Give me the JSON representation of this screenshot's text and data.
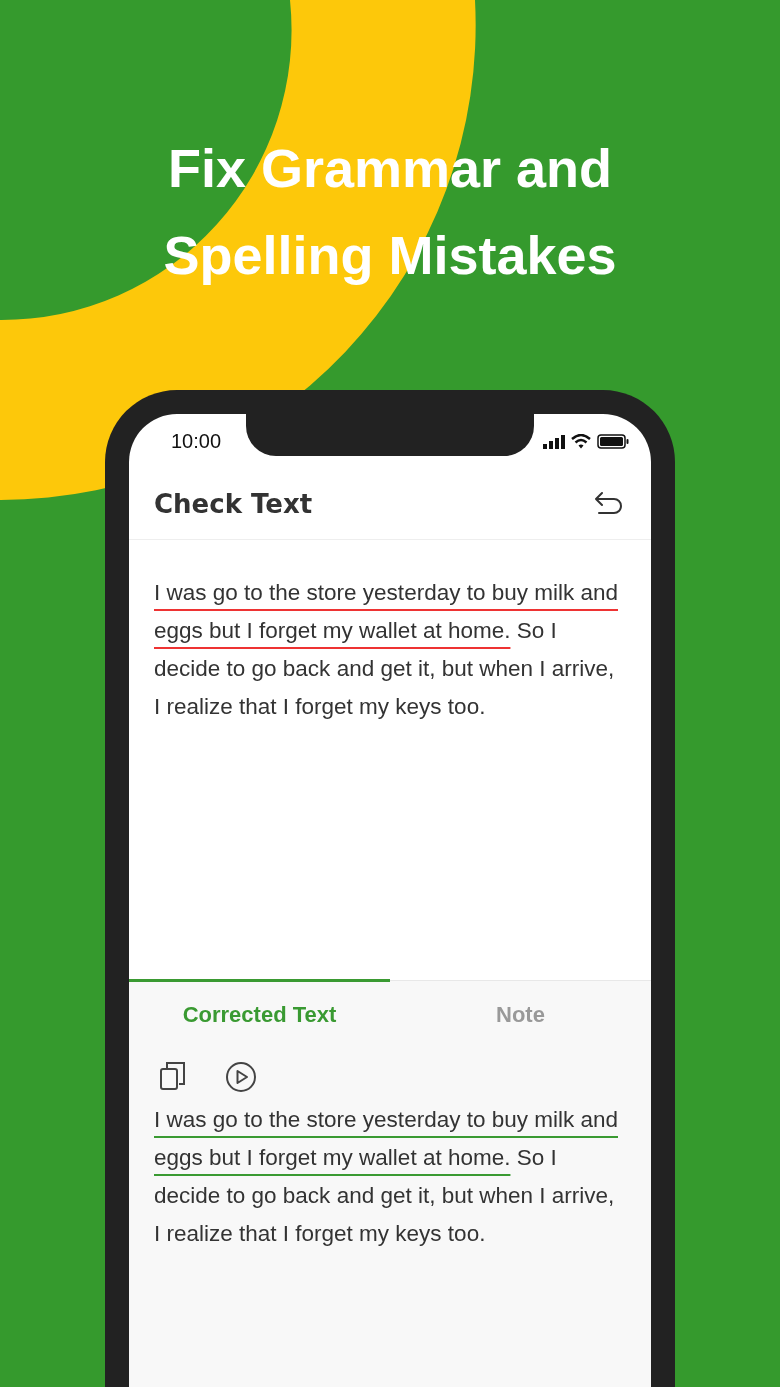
{
  "headline": [
    "Fix Grammar and",
    "Spelling Mistakes"
  ],
  "status_bar": {
    "time": "10:00"
  },
  "header": {
    "title": "Check Text"
  },
  "input_text": [
    {
      "text": "I was go to the store yesterday to buy milk and eggs but I forget my wallet at home.",
      "flagged": true
    },
    {
      "text": " So I decide to go back and get it, but when I arrive, I realize that I forget my keys too.",
      "flagged": false
    }
  ],
  "tabs": [
    {
      "label": "Corrected Text",
      "selected": true
    },
    {
      "label": "Note",
      "selected": false
    }
  ],
  "corrected_text": [
    {
      "text": "I was go to the store yesterday to buy milk and eggs but I forget my wallet at home.",
      "flagged": true
    },
    {
      "text": " So I decide to go back and get it, but when I arrive, I realize that I forget my keys too.",
      "flagged": false
    }
  ]
}
